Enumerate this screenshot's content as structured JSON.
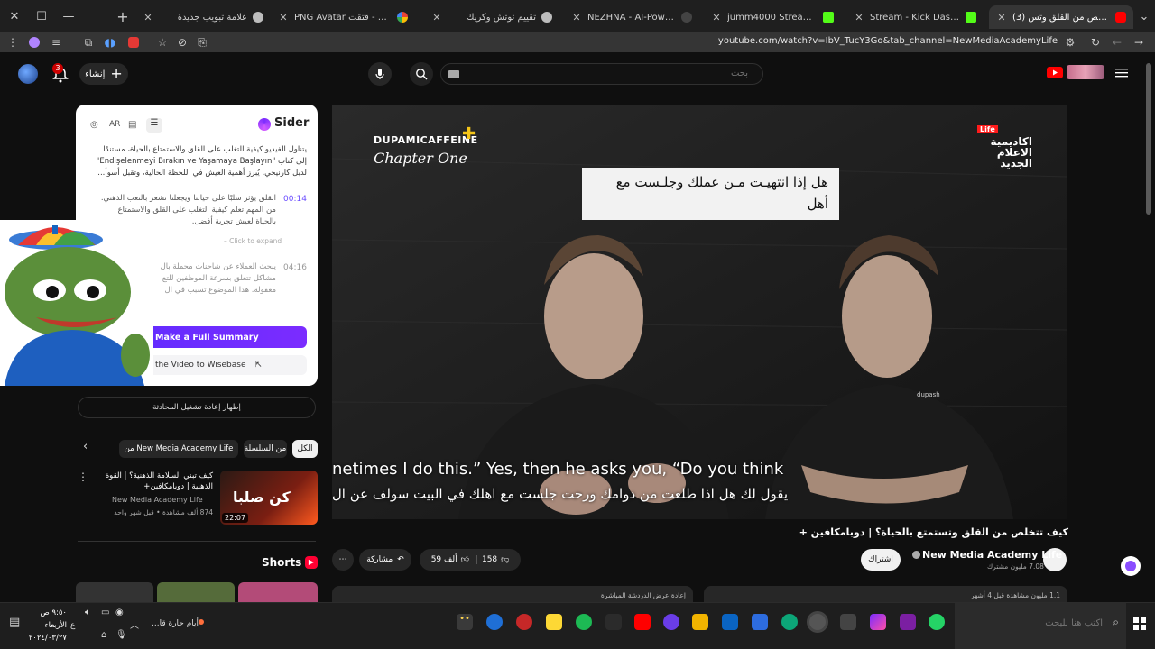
{
  "browser": {
    "tabs": [
      {
        "title": "(3) كيف تتخلص من القلق وتس",
        "active": true,
        "fav_color": "#ff0000"
      },
      {
        "title": "Stream - Kick Dashboard",
        "active": false,
        "fav_color": "#53fc18"
      },
      {
        "title": "jumm4000 Stream - Watch Live",
        "active": false,
        "fav_color": "#53fc18"
      },
      {
        "title": "NEZHNA - AI-Powered Live Stre",
        "active": false,
        "fav_color": "#444444"
      },
      {
        "title": "تقييم توتش وكريك",
        "active": false,
        "fav_color": "#bdbdbd"
      },
      {
        "title": "PNG Avatar قتقت - Google Sear",
        "active": false,
        "fav_color": "#4285f4"
      },
      {
        "title": "علامة تبويب جديدة",
        "active": false,
        "fav_color": "#bdbdbd"
      }
    ],
    "new_tab_label": "+",
    "url": "youtube.com/watch?v=IbV_TucY3Go&tab_channel=NewMediaAcademyLife"
  },
  "yt": {
    "search_placeholder": "بحث",
    "create_label": "إنشاء",
    "notif_count": "3"
  },
  "sider": {
    "brand": "Sider",
    "lang": "AR",
    "summary_lines": [
      "يتناول الفيديو كيفية التغلب على القلق والاستمتاع بالحياة، مستندًا",
      "إلى كتاب \"Endişelenmeyi Bırakın ve Yaşamaya Başlayın\"",
      "لديل كارنيجي. يُبرز أهمية العيش في اللحظة الحالية، وتقبل أسوأ..."
    ],
    "items": [
      {
        "time": "00:14",
        "lines": [
          "القلق يؤثر سلبًا على حياتنا ويجعلنا نشعر بالتعب الذهني.",
          "من المهم تعلم كيفية التغلب على القلق والاستمتاع",
          "بالحياة لعيش تجربة أفضل."
        ],
        "expand": "Click to expand"
      },
      {
        "time": "04:16",
        "lines": [
          "يبحث العملاء عن شاحنات محملة بال",
          "مشاكل تتعلق بسرعة الموظفين للتع",
          "معقولة. هذا الموضوع تسبب في ال"
        ]
      }
    ],
    "full_summary_label": "Make a Full Summary",
    "wisebase_label": "the Video to Wisebase"
  },
  "video": {
    "brand_top": "DUPAMICAFFEINE",
    "brand_sub": "Chapter One",
    "academy_tag": "Life",
    "academy_logo": "اكاديمية الاعلام الجديد",
    "bubble_text": "هل إذا انتهيـت مـن عملك وجلـست مع أهل",
    "shirt_brand": "dupash",
    "caption_en": "netimes I do this.” Yes, then he asks you, “Do you think",
    "caption_ar": "يقول لك هل اذا طلعت من دوامك ورحت جلست مع اهلك في البيت سولف عن ال",
    "title": "كيف تتخلص من القلق وتستمتع بالحياة؟ | دوبامكافين +",
    "channel": "New Media Academy Life",
    "subs": "7.08 مليون مشترك",
    "subscribe_label": "اشتراك",
    "likes": "59 ألف",
    "dislikes": "158",
    "share_label": "مشاركة",
    "desc_teaser": "1.1 مليون مشاهدة قبل 4 أشهر",
    "desc_teaser2": "إعادة عرض الدردشة المباشرة"
  },
  "side": {
    "replay_label": "إظهار إعادة تشغيل المحادثة",
    "chips": [
      {
        "label": "الكل",
        "selected": true
      },
      {
        "label": "من السلسلة",
        "selected": false
      },
      {
        "label": "من New Media Academy Life",
        "selected": false
      }
    ],
    "rec": {
      "title": "كيف تبني السلامة الذهنية؟ | القوة الذهنية | دوبامكافين+",
      "channel": "New Media Academy Life",
      "meta": "874 ألف مشاهدة • قبل شهر واحد",
      "duration": "22:07",
      "thumb_text": "كن صلبا"
    },
    "shorts_label": "Shorts"
  },
  "taskbar": {
    "search_placeholder": "اكتب هنا للبحث",
    "weather": "أيام حارة قا...",
    "time": "٩:٥٠ ص",
    "day": "الأربعاء",
    "date": "٢٠٢٤/٠٣/٢٧",
    "lang": "ع"
  },
  "colors": {
    "youtube_red": "#ff0000",
    "sider_purple": "#6a1eff",
    "kick_green": "#53fc18"
  }
}
